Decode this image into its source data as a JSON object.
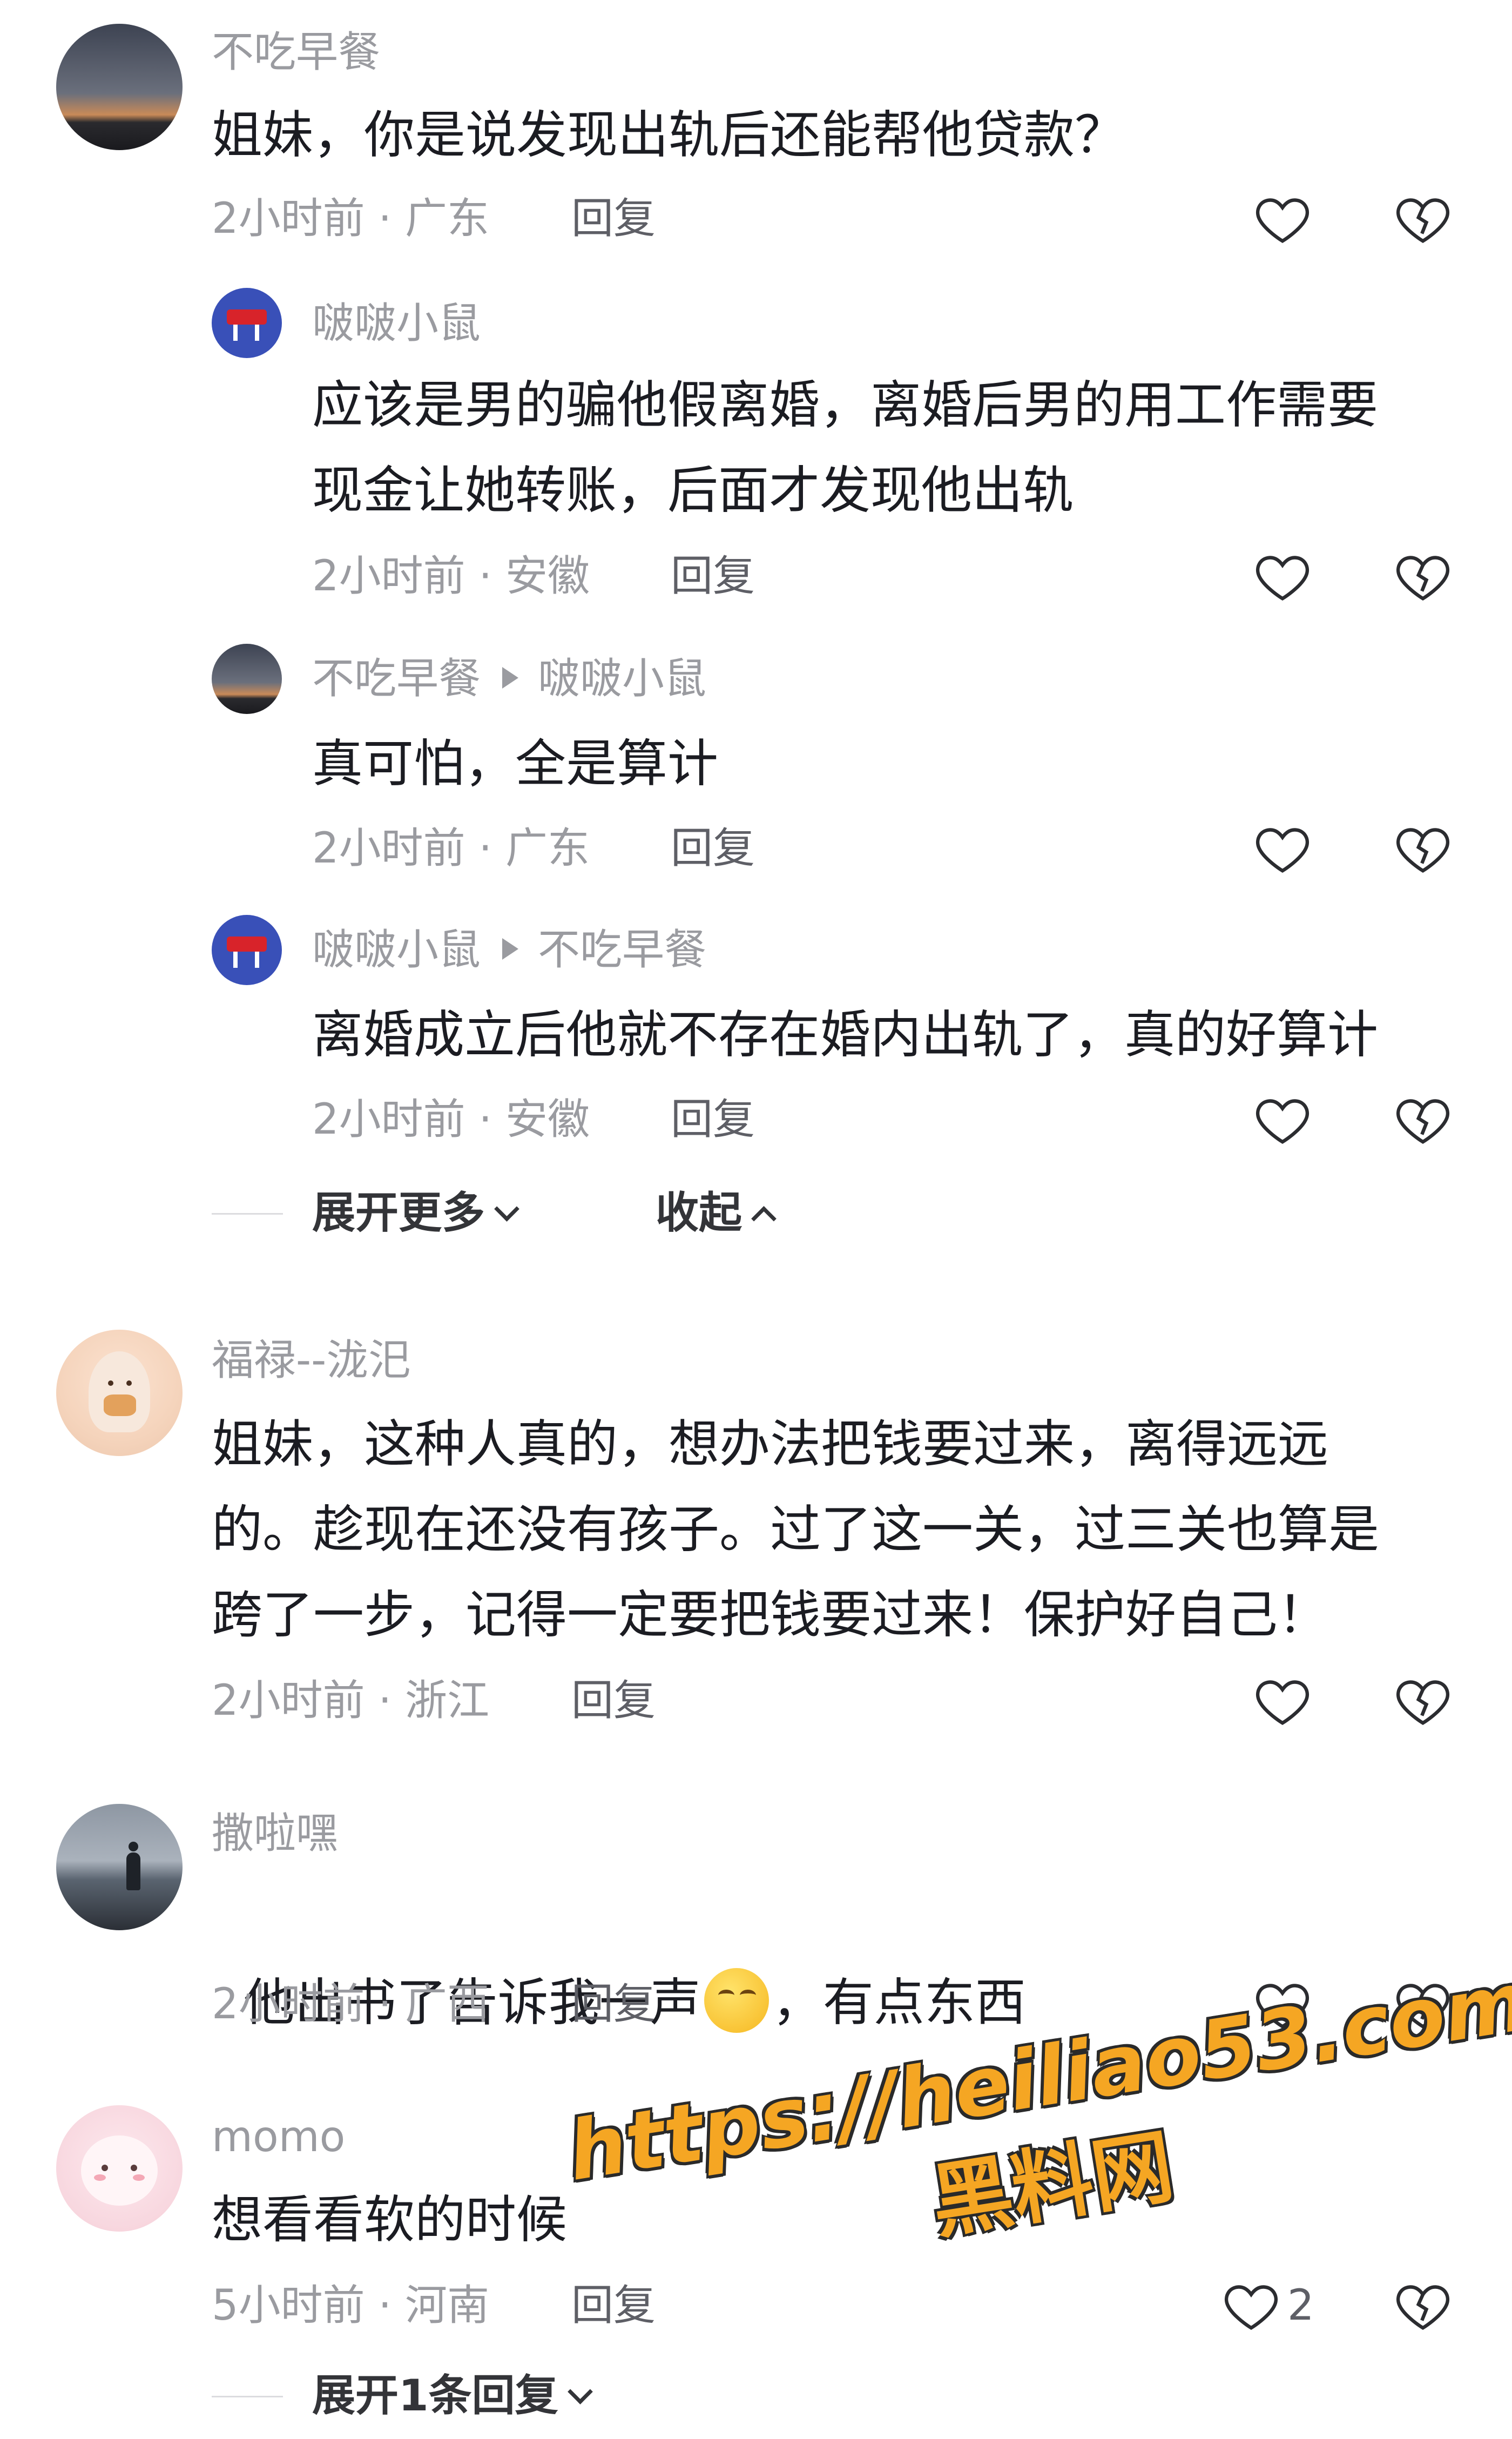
{
  "comments": [
    {
      "name": "不吃早餐",
      "text": "姐妹，你是说发现出轨后还能帮他贷款？",
      "time": "2小时前",
      "location": "广东",
      "reply_label": "回复"
    },
    {
      "name": "啵啵小鼠",
      "text": "应该是男的骗他假离婚，离婚后男的用工作需要\n现金让她转账，后面才发现他出轨",
      "time": "2小时前",
      "location": "安徽",
      "reply_label": "回复"
    },
    {
      "name": "不吃早餐",
      "reply_to": "啵啵小鼠",
      "text": "真可怕，全是算计",
      "time": "2小时前",
      "location": "广东",
      "reply_label": "回复"
    },
    {
      "name": "啵啵小鼠",
      "reply_to": "不吃早餐",
      "text": "离婚成立后他就不存在婚内出轨了，真的好算计",
      "time": "2小时前",
      "location": "安徽",
      "reply_label": "回复"
    },
    {
      "name": "福禄--泷汜",
      "text": "姐妹，这种人真的，想办法把钱要过来，离得远远\n的。趁现在还没有孩子。过了这一关，过三关也算是\n跨了一步，记得一定要把钱要过来！保护好自己！",
      "time": "2小时前",
      "location": "浙江",
      "reply_label": "回复"
    },
    {
      "name": "撒啦嘿",
      "text_before": "他出书了告诉我一声",
      "text_after": "，有点东西",
      "emoji": "shushing-face-emoji",
      "time": "2小时前",
      "location": "广西",
      "reply_label": "回复"
    },
    {
      "name": "momo",
      "text": "想看看软的时候",
      "time": "5小时前",
      "location": "河南",
      "reply_label": "回复",
      "like_count": "2"
    }
  ],
  "thread_controls": {
    "expand_more": "展开更多",
    "collapse": "收起",
    "expand_one": "展开1条回复"
  },
  "watermark": {
    "url": "https://heiliao53.com",
    "label": "黑料网"
  },
  "colors": {
    "secondary_text": "#9a9ba0",
    "primary_text": "#1b1c22",
    "watermark": "#f5a623"
  }
}
